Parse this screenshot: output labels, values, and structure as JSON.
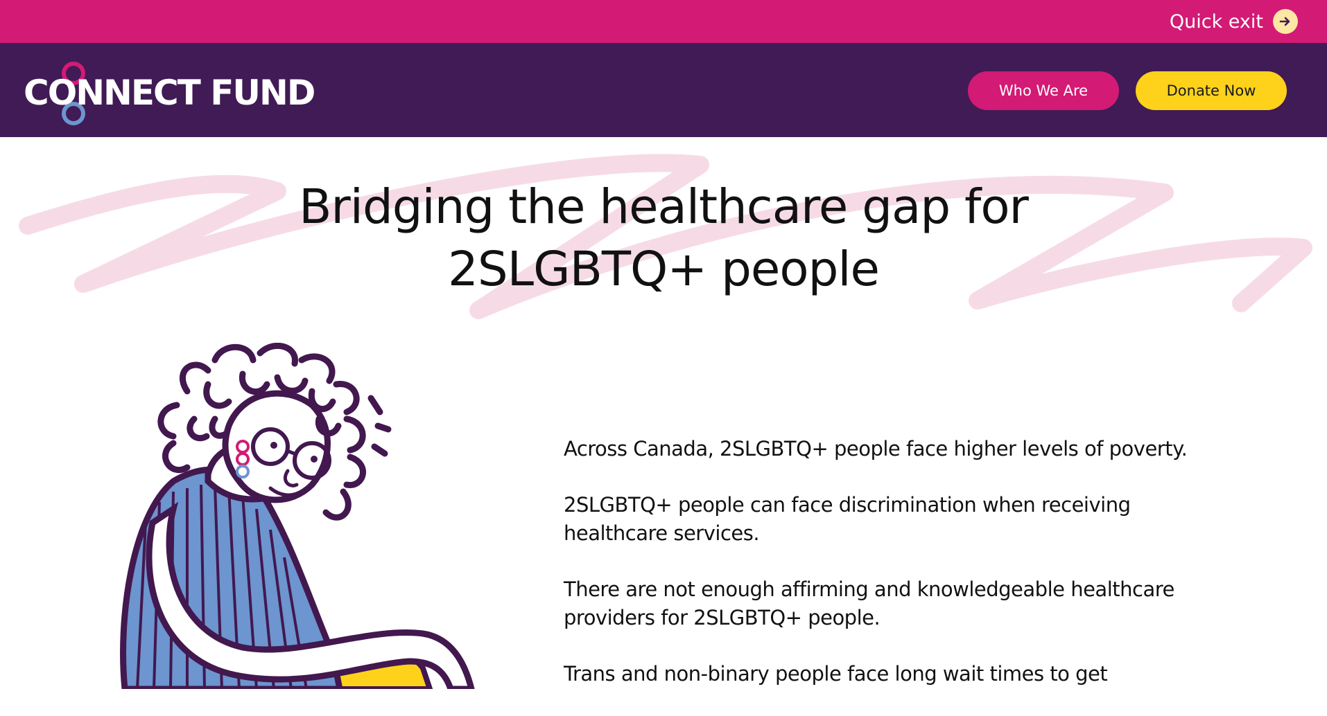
{
  "topbar": {
    "quick_exit_label": "Quick exit",
    "icon": "arrow-right-icon"
  },
  "header": {
    "logo_text": "CONNECT FUND",
    "who_we_are_label": "Who We Are",
    "donate_now_label": "Donate Now"
  },
  "hero": {
    "title_line1": "Bridging the healthcare gap for",
    "title_line2": "2SLGBTQ+ people"
  },
  "facts": [
    "Across Canada, 2SLGBTQ+ people face higher levels of poverty.",
    "2SLGBTQ+ people can face discrimination when receiving healthcare services.",
    "There are not enough affirming and knowledgeable healthcare providers for 2SLGBTQ+ people.",
    "Trans and non-binary people face long wait times to get"
  ],
  "colors": {
    "topbar": "#d31a74",
    "navbar": "#401b55",
    "who_button": "#d31a74",
    "donate_button": "#fed21b",
    "squiggle": "#f6dbe6",
    "illustration_outline": "#42184f",
    "illustration_blue": "#6d95cf",
    "illustration_yellow": "#fed21b"
  }
}
